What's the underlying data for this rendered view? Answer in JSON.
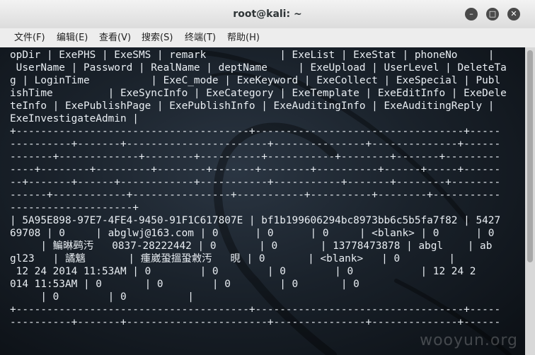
{
  "window": {
    "title": "root@kali: ~",
    "minimize_glyph": "–",
    "maximize_glyph": "□",
    "close_glyph": "✕"
  },
  "menubar": [
    "文件(F)",
    "编辑(E)",
    "查看(V)",
    "搜索(S)",
    "终端(T)",
    "帮助(H)"
  ],
  "terminal": {
    "lines": [
      "opDir | ExePHS | ExeSMS | remark            | ExeList | ExeStat | phoneNo     |",
      " UserName | Password | RealName | deptName     | ExeUpload | UserLevel | DeleteTa",
      "g | LoginTime          | ExeC_mode | ExeKeyword | ExeCollect | ExeSpecial | Publ",
      "ishTime         | ExeSyncInfo | ExeCategory | ExeTemplate | ExeEditInfo | ExeDele",
      "teInfo | ExePublishPage | ExePublishInfo | ExeAuditingInfo | ExeAuditingReply |",
      "ExeInvestigateAdmin |",
      "+--------------------------------------+----------------------------------+-----",
      "----------+-------+-----------------------+---------------+--------------+------",
      "-------+-------------+--------+----------+-----------+--------+-------+---------",
      "----+--------+---------+--------+-------+--------+----------+------+-----+------",
      "--+-------+------+------------+-----------+-----------+-------+--------+--------",
      "------+------------+----------------+-----------+----------+--------+-----------",
      "--------------------+",
      "| 5A95E898-97E7-4FE4-9450-91F1C617807E | bf1b199606294bc8973bb6c5b5fa7f82 | 5427",
      "69708 | 0     | abglwj@163.com | 0      | 0      | 0     | <blank> | 0      | 0",
      "     | 鳊晽鹀汚   0837-28222442 | 0       | 0       | 13778473878 | abgl    | ab",
      "gl23   | 譎魑       | 瘇崴蛩搵蛩敹汚   晛 | 0       | <blank>   | 0        |",
      " 12 24 2014 11:53AM | 0        | 0        | 0        | 0           | 12 24 2",
      "014 11:53AM | 0       | 0        | 0        | 0       | 0",
      "     | 0        | 0          |",
      "+--------------------------------------+----------------------------------+-----",
      "----------+-------+-----------------------+---------------+--------------+------"
    ]
  },
  "watermark": "wooyun.org",
  "colors": {
    "terminal_text": "#e9eef3",
    "terminal_bg": "#1a222b",
    "titlebar_bg": "#e6e6e6"
  }
}
